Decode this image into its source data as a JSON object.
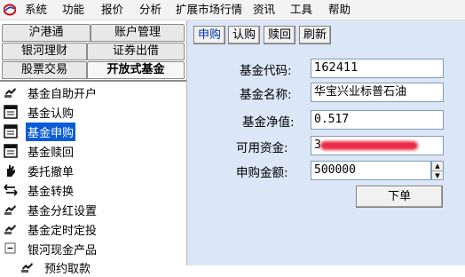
{
  "menu": [
    "系统",
    "功能",
    "报价",
    "分析",
    "扩展市场行情",
    "资讯",
    "工具",
    "帮助"
  ],
  "left_tabs": {
    "row1": [
      "沪港通",
      "账户管理"
    ],
    "row2": [
      "银河理财",
      "证券出借"
    ],
    "row3": [
      "股票交易",
      "开放式基金"
    ]
  },
  "tree": [
    {
      "label": "基金自助开户",
      "icon": "hand-coins-icon"
    },
    {
      "label": "基金认购",
      "icon": "form-document-icon"
    },
    {
      "label": "基金申购",
      "icon": "form-document-icon",
      "selected": true
    },
    {
      "label": "基金赎回",
      "icon": "form-document-icon"
    },
    {
      "label": "委托撤单",
      "icon": "hand-cancel-icon"
    },
    {
      "label": "基金转换",
      "icon": "exchange-arrows-icon"
    },
    {
      "label": "基金分红设置",
      "icon": "hand-coins-icon"
    },
    {
      "label": "基金定时定投",
      "icon": "hand-coins-icon"
    },
    {
      "label": "银河现金产品",
      "icon": "collapse-minus-icon"
    },
    {
      "label": "预约取款",
      "icon": "hand-coins-icon"
    }
  ],
  "toolbar": {
    "buttons": [
      "申购",
      "认购",
      "赎回",
      "刷新"
    ],
    "active": "申购"
  },
  "form": {
    "fund_code_label": "基金代码:",
    "fund_code": "162411",
    "fund_name_label": "基金名称:",
    "fund_name": "华宝兴业标普石油",
    "nav_label": "基金净值:",
    "nav": "0.517",
    "available_label": "可用资金:",
    "available_visible": "3",
    "amount_label": "申购金额:",
    "amount": "500000",
    "submit_label": "下单"
  },
  "colors": {
    "selection": "#0a5cd8",
    "form_background": "#dbe6f6",
    "redaction": "#e8203a"
  }
}
